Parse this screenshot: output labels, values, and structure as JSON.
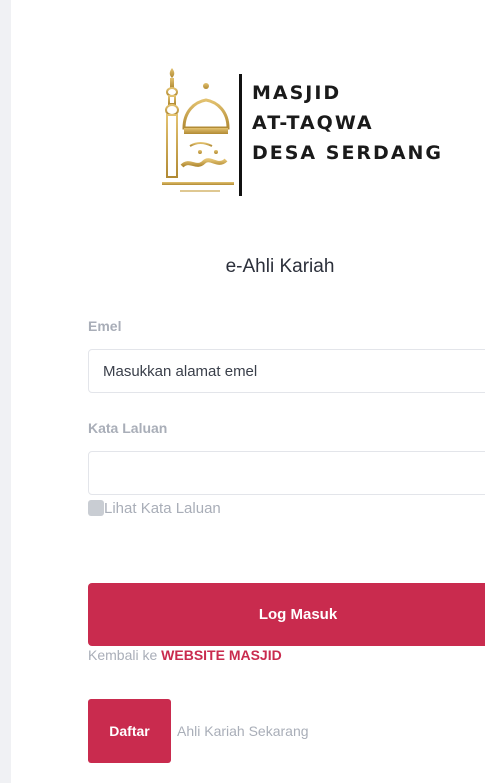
{
  "logo": {
    "line1": "MASJID",
    "line2": "AT-TAQWA",
    "line3": "DESA SERDANG",
    "emblem_icon": "mosque-dome-icon",
    "gold": "#c9a34a",
    "divider_color": "#111111"
  },
  "app_title": "e-Ahli Kariah",
  "email": {
    "label": "Emel",
    "placeholder": "Masukkan alamat emel",
    "value": ""
  },
  "password": {
    "label": "Kata Laluan",
    "placeholder": "",
    "value": ""
  },
  "show_password": {
    "label": "Lihat Kata Laluan",
    "checked": false
  },
  "login_button": "Log Masuk",
  "back_link": {
    "prefix": "Kembali ke ",
    "link_text": "WEBSITE MASJID"
  },
  "register": {
    "button": "Daftar",
    "note": "Ahli Kariah Sekarang"
  },
  "colors": {
    "accent": "#c92b4e",
    "muted_text": "#a9aeb8",
    "title_text": "#2b2f3a",
    "border": "#e3e5ea"
  }
}
